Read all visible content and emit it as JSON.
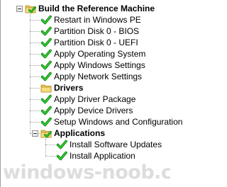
{
  "tree": {
    "root": {
      "label": "Build the Reference Machine",
      "icon": "folder-check-icon",
      "expanded": true,
      "children": [
        {
          "label": "Restart in Windows PE",
          "icon": "green-check-icon"
        },
        {
          "label": "Partition Disk 0 - BIOS",
          "icon": "green-check-icon"
        },
        {
          "label": "Partition Disk 0 - UEFI",
          "icon": "green-check-icon"
        },
        {
          "label": "Apply Operating System",
          "icon": "green-check-icon"
        },
        {
          "label": "Apply Windows Settings",
          "icon": "green-check-icon"
        },
        {
          "label": "Apply Network Settings",
          "icon": "green-check-icon"
        },
        {
          "label": "Drivers",
          "icon": "folder-icon",
          "group": true
        },
        {
          "label": "Apply Driver Package",
          "icon": "green-check-icon"
        },
        {
          "label": "Apply Device Drivers",
          "icon": "green-check-icon"
        },
        {
          "label": "Setup Windows and Configuration",
          "icon": "green-check-icon"
        },
        {
          "label": "Applications",
          "icon": "folder-check-icon",
          "group": true,
          "expanded": true,
          "children": [
            {
              "label": "Install Software Updates",
              "icon": "green-check-icon"
            },
            {
              "label": "Install Application",
              "icon": "green-check-icon"
            }
          ]
        }
      ]
    }
  },
  "watermark": "windows-noob.com"
}
